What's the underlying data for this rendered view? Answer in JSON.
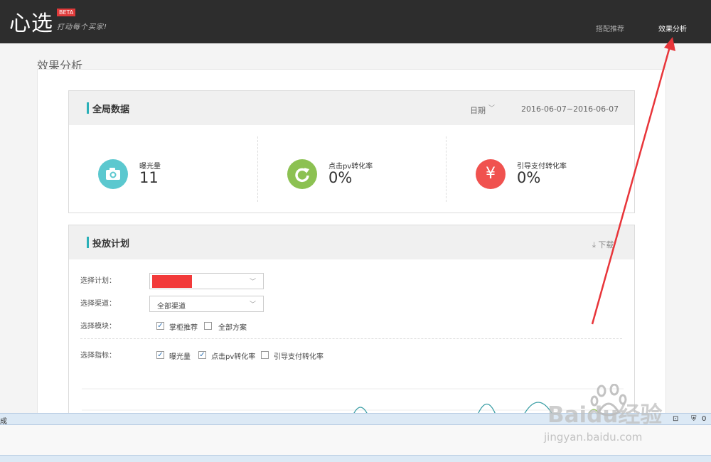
{
  "header": {
    "logo": "心选",
    "beta": "BETA",
    "slogan": "打动每个买家!",
    "nav": [
      "搭配推荐",
      "效果分析"
    ]
  },
  "page": {
    "title": "效果分析"
  },
  "global_data": {
    "title": "全局数据",
    "date_label": "日期",
    "date_range": "2016-06-07~2016-06-07",
    "metrics": [
      {
        "label": "曝光量",
        "value": "11",
        "icon": "camera-icon",
        "color": "#5bc8cf"
      },
      {
        "label": "点击pv转化率",
        "value": "0%",
        "icon": "refresh-icon",
        "color": "#8cc152"
      },
      {
        "label": "引导支付转化率",
        "value": "0%",
        "icon": "yen-icon",
        "color": "#f0524f"
      }
    ]
  },
  "plan": {
    "title": "投放计划",
    "download": "下载",
    "select_plan_label": "选择计划：",
    "select_channel_label": "选择渠道：",
    "channel_value": "全部渠道",
    "select_module_label": "选择模块：",
    "modules": [
      {
        "label": "掌柜推荐",
        "checked": true
      },
      {
        "label": "全部方案",
        "checked": false
      }
    ],
    "select_metric_label": "选择指标：",
    "metric_options": [
      {
        "label": "曝光量",
        "checked": true
      },
      {
        "label": "点击pv转化率",
        "checked": true
      },
      {
        "label": "引导支付转化率",
        "checked": false
      }
    ]
  },
  "statusbar": {
    "text": "成",
    "counter": "0"
  },
  "watermark": {
    "text": "Baidu经验",
    "url": "jingyan.baidu.com"
  },
  "colors": {
    "accent": "#2ab0b8",
    "arrow": "#e8353a",
    "header": "#2d2d2d"
  }
}
